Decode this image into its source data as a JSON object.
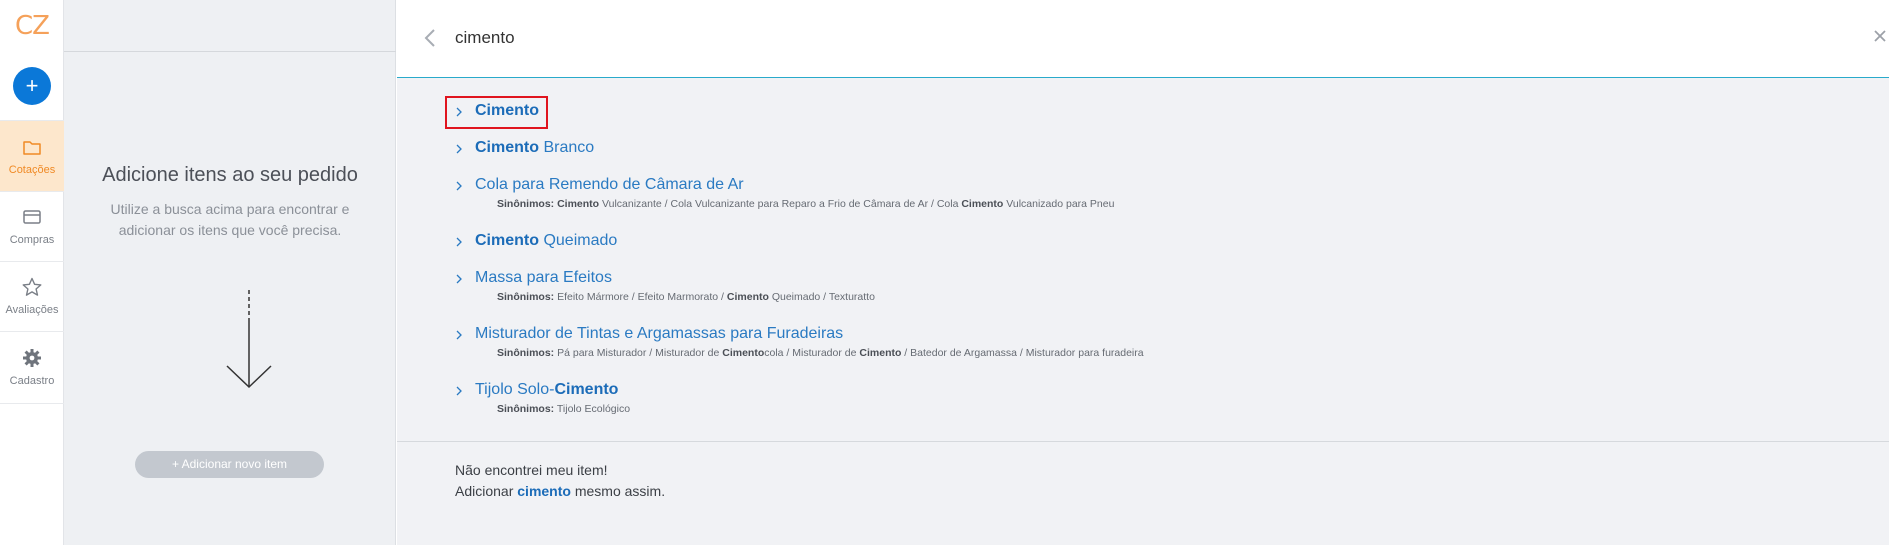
{
  "nav": {
    "logo": "CZ",
    "add_label": "+",
    "items": [
      {
        "label": "Cotações",
        "icon": "folder-icon",
        "active": true
      },
      {
        "label": "Compras",
        "icon": "card-icon",
        "active": false
      },
      {
        "label": "Avaliações",
        "icon": "star-icon",
        "active": false
      },
      {
        "label": "Cadastro",
        "icon": "gear-icon",
        "active": false
      }
    ]
  },
  "middle": {
    "title": "Adicione itens ao seu pedido",
    "subtitle": "Utilize a busca acima para encontrar e adicionar os itens que você precisa.",
    "new_item_button": "+ Adicionar novo item"
  },
  "search": {
    "value": "cimento",
    "placeholder": ""
  },
  "results": [
    {
      "title_bold": "Cimento",
      "title_rest": "",
      "synonyms_label": "",
      "synonyms": "",
      "highlighted": true
    },
    {
      "title_bold": "Cimento",
      "title_rest": " Branco",
      "synonyms_label": "",
      "synonyms": "",
      "highlighted": false
    },
    {
      "title_pre": "Cola para Remendo de Câmara de Ar",
      "title_bold": "",
      "title_rest": "",
      "synonyms_label": "Sinônimos:",
      "synonyms_pre": " ",
      "synonyms_bold1": "Cimento",
      "synonyms_mid": " Vulcanizante / Cola Vulcanizante para Reparo a Frio de Câmara de Ar / Cola ",
      "synonyms_bold2": "Cimento",
      "synonyms_post": " Vulcanizado para Pneu"
    },
    {
      "title_bold": "Cimento",
      "title_rest": " Queimado",
      "synonyms_label": "",
      "synonyms": ""
    },
    {
      "title_pre": "Massa para Efeitos",
      "synonyms_label": "Sinônimos:",
      "synonyms_pre": " Efeito Mármore / Efeito Marmorato / ",
      "synonyms_bold1": "Cimento",
      "synonyms_mid": " Queimado / Texturatto",
      "synonyms_bold2": "",
      "synonyms_post": ""
    },
    {
      "title_pre": "Misturador de Tintas e Argamassas para Furadeiras",
      "synonyms_label": "Sinônimos:",
      "synonyms_pre": " Pá para Misturador / Misturador de ",
      "synonyms_bold1": "Cimento",
      "synonyms_mid": "cola / Misturador de ",
      "synonyms_bold2": "Cimento",
      "synonyms_post": " / Batedor de Argamassa / Misturador para furadeira"
    },
    {
      "title_pre": "Tijolo Solo-",
      "title_bold": "Cimento",
      "synonyms_label": "Sinônimos:",
      "synonyms_pre": " Tijolo Ecológico",
      "synonyms_bold1": "",
      "synonyms_mid": "",
      "synonyms_bold2": "",
      "synonyms_post": ""
    }
  ],
  "not_found": {
    "line1": "Não encontrei meu item!",
    "line2_pre": "Adicionar ",
    "line2_term": "cimento",
    "line2_post": " mesmo assim."
  },
  "colors": {
    "accent": "#0b78d8",
    "nav_active_bg": "#fde7cc",
    "nav_active_text": "#f08a25",
    "link": "#2a7ac2",
    "highlight": "#e0141e"
  }
}
